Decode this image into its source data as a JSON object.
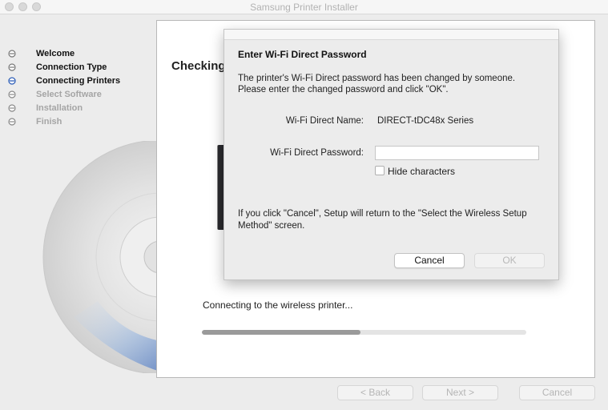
{
  "window": {
    "title": "Samsung Printer Installer"
  },
  "steps": [
    {
      "label": "Welcome",
      "state": "done"
    },
    {
      "label": "Connection Type",
      "state": "done"
    },
    {
      "label": "Connecting Printers",
      "state": "current"
    },
    {
      "label": "Select Software",
      "state": "pending"
    },
    {
      "label": "Installation",
      "state": "pending"
    },
    {
      "label": "Finish",
      "state": "pending"
    }
  ],
  "main": {
    "heading": "Checking",
    "status": "Connecting to the wireless printer...",
    "progress": 0.49
  },
  "dialog": {
    "title": "Enter Wi-Fi Direct Password",
    "message_line1": "The printer's Wi-Fi Direct password has been changed by someone.",
    "message_line2": "Please enter the changed password and click \"OK\".",
    "name_label": "Wi-Fi Direct Name:",
    "name_value": "DIRECT-tDC48x Series",
    "password_label": "Wi-Fi Direct Password:",
    "password_value": "",
    "hide_label": "Hide characters",
    "hide_checked": false,
    "note_line1": "If you click \"Cancel\", Setup will return to the \"Select the Wireless Setup",
    "note_line2": "Method\" screen.",
    "cancel_label": "Cancel",
    "ok_label": "OK"
  },
  "footer": {
    "back_label": "< Back",
    "next_label": "Next >",
    "cancel_label": "Cancel"
  },
  "colors": {
    "current_step": "#2f5fb8",
    "done_step": "#111111",
    "pending_step": "#a5a5a5"
  }
}
